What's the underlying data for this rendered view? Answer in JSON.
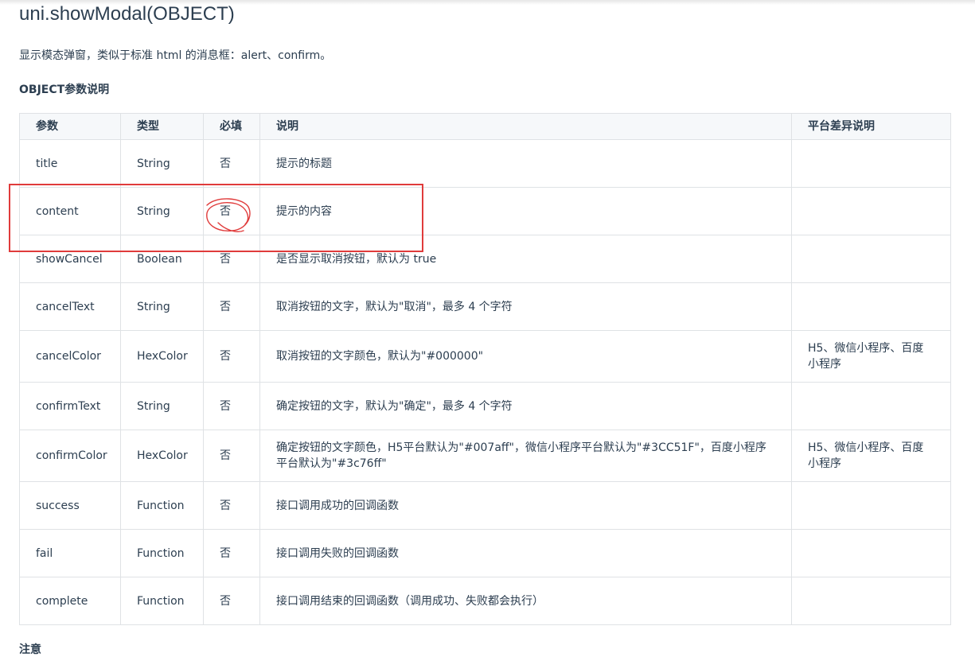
{
  "doc": {
    "title": "uni.showModal(OBJECT)",
    "description": "显示模态弹窗，类似于标准 html 的消息框：alert、confirm。",
    "params_heading": "OBJECT参数说明",
    "footer_heading": "注意"
  },
  "table": {
    "headers": [
      "参数",
      "类型",
      "必填",
      "说明",
      "平台差异说明"
    ],
    "rows": [
      {
        "name": "title",
        "type": "String",
        "required": "否",
        "desc": "提示的标题",
        "platform": ""
      },
      {
        "name": "content",
        "type": "String",
        "required": "否",
        "desc": "提示的内容",
        "platform": ""
      },
      {
        "name": "showCancel",
        "type": "Boolean",
        "required": "否",
        "desc": "是否显示取消按钮，默认为 true",
        "platform": ""
      },
      {
        "name": "cancelText",
        "type": "String",
        "required": "否",
        "desc": "取消按钮的文字，默认为\"取消\"，最多 4 个字符",
        "platform": ""
      },
      {
        "name": "cancelColor",
        "type": "HexColor",
        "required": "否",
        "desc": "取消按钮的文字颜色，默认为\"#000000\"",
        "platform": "H5、微信小程序、百度小程序"
      },
      {
        "name": "confirmText",
        "type": "String",
        "required": "否",
        "desc": "确定按钮的文字，默认为\"确定\"，最多 4 个字符",
        "platform": ""
      },
      {
        "name": "confirmColor",
        "type": "HexColor",
        "required": "否",
        "desc": "确定按钮的文字颜色，H5平台默认为\"#007aff\"，微信小程序平台默认为\"#3CC51F\"，百度小程序平台默认为\"#3c76ff\"",
        "platform": "H5、微信小程序、百度小程序"
      },
      {
        "name": "success",
        "type": "Function",
        "required": "否",
        "desc": "接口调用成功的回调函数",
        "platform": ""
      },
      {
        "name": "fail",
        "type": "Function",
        "required": "否",
        "desc": "接口调用失败的回调函数",
        "platform": ""
      },
      {
        "name": "complete",
        "type": "Function",
        "required": "否",
        "desc": "接口调用结束的回调函数（调用成功、失败都会执行）",
        "platform": ""
      }
    ]
  },
  "colors": {
    "text": "#2c3e50",
    "border": "#dfe2e5",
    "header_bg": "#f6f8fa",
    "annotation": "#e03b3b"
  }
}
